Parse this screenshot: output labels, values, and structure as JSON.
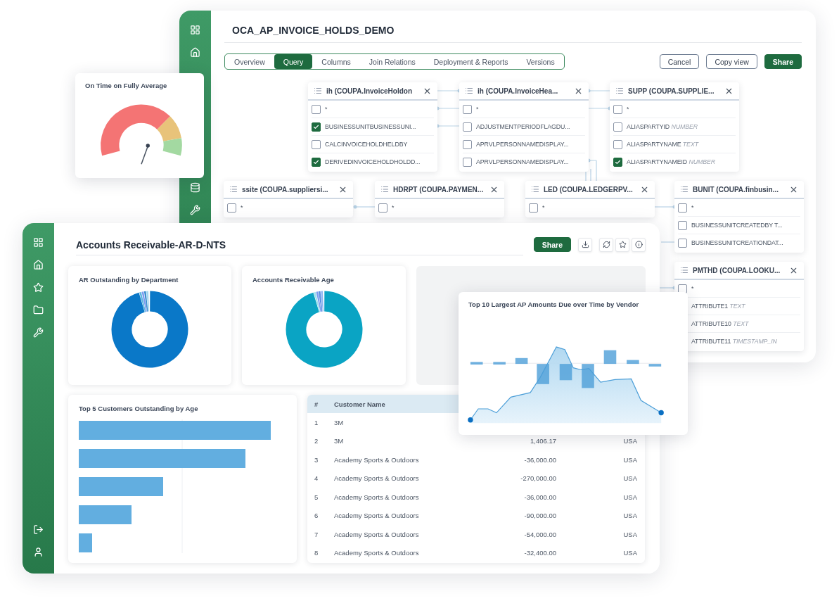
{
  "query_window": {
    "title": "OCA_AP_INVOICE_HOLDS_DEMO",
    "tabs": [
      {
        "label": "Overview",
        "selected": false
      },
      {
        "label": "Query",
        "selected": true
      },
      {
        "label": "Columns",
        "selected": false
      },
      {
        "label": "Join Relations",
        "selected": false
      },
      {
        "label": "Deployment & Reports",
        "selected": false
      },
      {
        "label": "Versions",
        "selected": false
      }
    ],
    "buttons": [
      {
        "label": "Cancel",
        "kind": "outline"
      },
      {
        "label": "Copy view",
        "kind": "outline"
      },
      {
        "label": "Share",
        "kind": "primary"
      }
    ],
    "nodes": [
      {
        "title": "ih (COUPA.InvoiceHoldon",
        "rows": [
          {
            "label": "*",
            "checked": false
          },
          {
            "label": "BUSINESSUNITBUSINESSUNI...",
            "checked": true
          },
          {
            "label": "CALCINVOICEHOLDHELDBY",
            "checked": false
          },
          {
            "label": "DERIVEDINVOICEHOLDHOLDD...",
            "checked": true
          }
        ]
      },
      {
        "title": "ih (COUPA.InvoiceHea...",
        "rows": [
          {
            "label": "*",
            "checked": false
          },
          {
            "label": "ADJUSTMENTPERIODFLAGDU...",
            "checked": false
          },
          {
            "label": "APRVLPERSONNAMEDISPLAY...",
            "checked": false
          },
          {
            "label": "APRVLPERSONNAMEDISPLAY...",
            "checked": false
          }
        ]
      },
      {
        "title": "SUPP (COUPA.SUPPLIE...",
        "rows": [
          {
            "label": "*",
            "checked": false
          },
          {
            "label": "ALIASPARTYID",
            "type": "NUMBER",
            "checked": false
          },
          {
            "label": "ALIASPARTYNAME",
            "type": "TEXT",
            "checked": false
          },
          {
            "label": "ALIASPARTYNAMEID",
            "type": "NUMBER",
            "checked": true
          }
        ]
      },
      {
        "title": "ssite (COUPA.suppliersi...",
        "rows": [
          {
            "label": "*",
            "checked": false
          }
        ]
      },
      {
        "title": "HDRPT (COUPA.PAYMEN...",
        "rows": [
          {
            "label": "*",
            "checked": false
          }
        ]
      },
      {
        "title": "LED (COUPA.LEDGERPV...",
        "rows": [
          {
            "label": "*",
            "checked": false
          }
        ]
      },
      {
        "title": "BUNIT (COUPA.finbusin...",
        "rows": [
          {
            "label": "*",
            "checked": false
          },
          {
            "label": "BUSINESSUNITCREATEDBY T...",
            "checked": false
          },
          {
            "label": "BUSINESSUNITCREATIONDAT...",
            "checked": false
          }
        ]
      },
      {
        "title": "PMTHD (COUPA.LOOKU...",
        "rows": [
          {
            "label": "*",
            "checked": false
          },
          {
            "label": "ATTRIBUTE1",
            "type": "TEXT"
          },
          {
            "label": "ATTRIBUTE10",
            "type": "TEXT"
          },
          {
            "label": "ATTRIBUTE11",
            "type": "TIMESTAMP_IN"
          }
        ]
      }
    ]
  },
  "gauge_card": {
    "title": "On Time on Fully Average"
  },
  "dashboard": {
    "title": "Accounts Receivable-AR-D-NTS",
    "share": "Share",
    "cards": [
      {
        "title": "AR Outstanding by Department"
      },
      {
        "title": "Accounts Receivable Age"
      },
      {
        "title": "Top 5 Customers Outstanding by Age"
      }
    ],
    "table": {
      "columns": [
        "#",
        "Customer Name"
      ],
      "rows": [
        {
          "index": "1",
          "name": "3M"
        },
        {
          "index": "2",
          "name": "3M",
          "amount": "1,406.17",
          "country": "USA"
        },
        {
          "index": "3",
          "name": "Academy Sports & Outdoors",
          "amount": "-36,000.00",
          "country": "USA"
        },
        {
          "index": "4",
          "name": "Academy Sports & Outdoors",
          "amount": "-270,000.00",
          "country": "USA"
        },
        {
          "index": "5",
          "name": "Academy Sports & Outdoors",
          "amount": "-36,000.00",
          "country": "USA"
        },
        {
          "index": "6",
          "name": "Academy Sports & Outdoors",
          "amount": "-90,000.00",
          "country": "USA"
        },
        {
          "index": "7",
          "name": "Academy Sports & Outdoors",
          "amount": "-54,000.00",
          "country": "USA"
        },
        {
          "index": "8",
          "name": "Academy Sports & Outdoors",
          "amount": "-32,400.00",
          "country": "USA"
        }
      ]
    }
  },
  "chart_popup": {
    "title": "Top 10 Largest AP Amounts Due over Time by Vendor"
  }
}
